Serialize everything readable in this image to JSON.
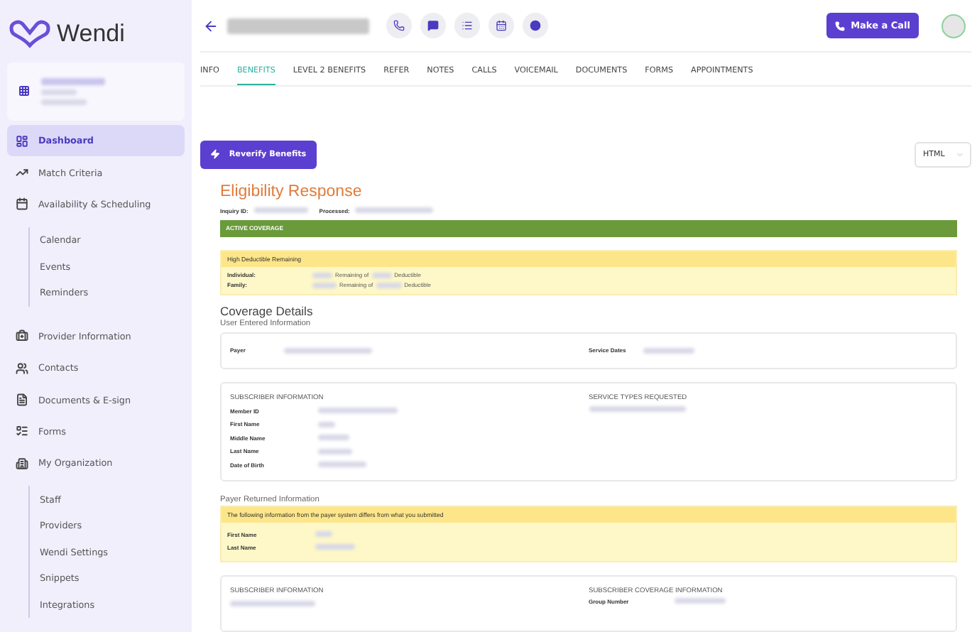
{
  "sidebar": {
    "logo": "Wendi",
    "items": [
      {
        "label": "Dashboard",
        "kind": "main",
        "selected": true
      },
      {
        "label": "Match Criteria",
        "kind": "main",
        "selected": false
      },
      {
        "label": "Availability & Scheduling",
        "kind": "main",
        "selected": false
      },
      {
        "label": "Calendar",
        "kind": "sub",
        "selected": false
      },
      {
        "label": "Events",
        "kind": "sub",
        "selected": false
      },
      {
        "label": "Reminders",
        "kind": "sub",
        "selected": false
      },
      {
        "label": "Provider Information",
        "kind": "main",
        "selected": false
      },
      {
        "label": "Contacts",
        "kind": "main",
        "selected": false
      },
      {
        "label": "Documents & E-sign",
        "kind": "main",
        "selected": false
      },
      {
        "label": "Forms",
        "kind": "main",
        "selected": false
      },
      {
        "label": "My Organization",
        "kind": "main",
        "selected": false
      },
      {
        "label": "Staff",
        "kind": "sub",
        "selected": false
      },
      {
        "label": "Providers",
        "kind": "sub",
        "selected": false
      },
      {
        "label": "Wendi Settings",
        "kind": "sub",
        "selected": false
      },
      {
        "label": "Snippets",
        "kind": "sub",
        "selected": false
      },
      {
        "label": "Integrations",
        "kind": "sub",
        "selected": false
      }
    ]
  },
  "header": {
    "call_button": "Make a Call"
  },
  "tabs": [
    {
      "label": "INFO",
      "selected": false
    },
    {
      "label": "BENEFITS",
      "selected": true
    },
    {
      "label": "LEVEL 2 BENEFITS",
      "selected": false
    },
    {
      "label": "REFER",
      "selected": false
    },
    {
      "label": "NOTES",
      "selected": false
    },
    {
      "label": "CALLS",
      "selected": false
    },
    {
      "label": "VOICEMAIL",
      "selected": false
    },
    {
      "label": "DOCUMENTS",
      "selected": false
    },
    {
      "label": "FORMS",
      "selected": false
    },
    {
      "label": "APPOINTMENTS",
      "selected": false
    }
  ],
  "toolbar": {
    "reverify_button": "Reverify Benefits",
    "format_select": {
      "value": "HTML"
    }
  },
  "report": {
    "title": "Eligibility Response",
    "inquiry_label": "Inquiry ID:",
    "processed_label": "Processed:",
    "status": "ACTIVE COVERAGE",
    "deductible": {
      "title": "High Deductible Remaining",
      "rows": [
        {
          "label": "Individual:",
          "middle": "Remaining of",
          "end": "Deductible"
        },
        {
          "label": "Family:",
          "middle": "Remaining of",
          "end": "Deductible"
        }
      ]
    },
    "coverage_heading": "Coverage Details",
    "user_entered_heading": "User Entered Information",
    "payer_card": {
      "left_label": "Payer",
      "right_label": "Service Dates"
    },
    "subscriber_card": {
      "left_title": "SUBSCRIBER INFORMATION",
      "fields": [
        "Member ID",
        "First Name",
        "Middle Name",
        "Last Name",
        "Date of Birth"
      ],
      "right_title": "SERVICE TYPES REQUESTED"
    },
    "payer_returned_heading": "Payer Returned Information",
    "differs": {
      "notice": "The following information from the payer system differs from what you submitted",
      "fields": [
        "First Name",
        "Last Name"
      ]
    },
    "bottom_card": {
      "left_title": "SUBSCRIBER INFORMATION",
      "right_title": "SUBSCRIBER COVERAGE INFORMATION",
      "right_fields": [
        "Group Number"
      ]
    }
  }
}
